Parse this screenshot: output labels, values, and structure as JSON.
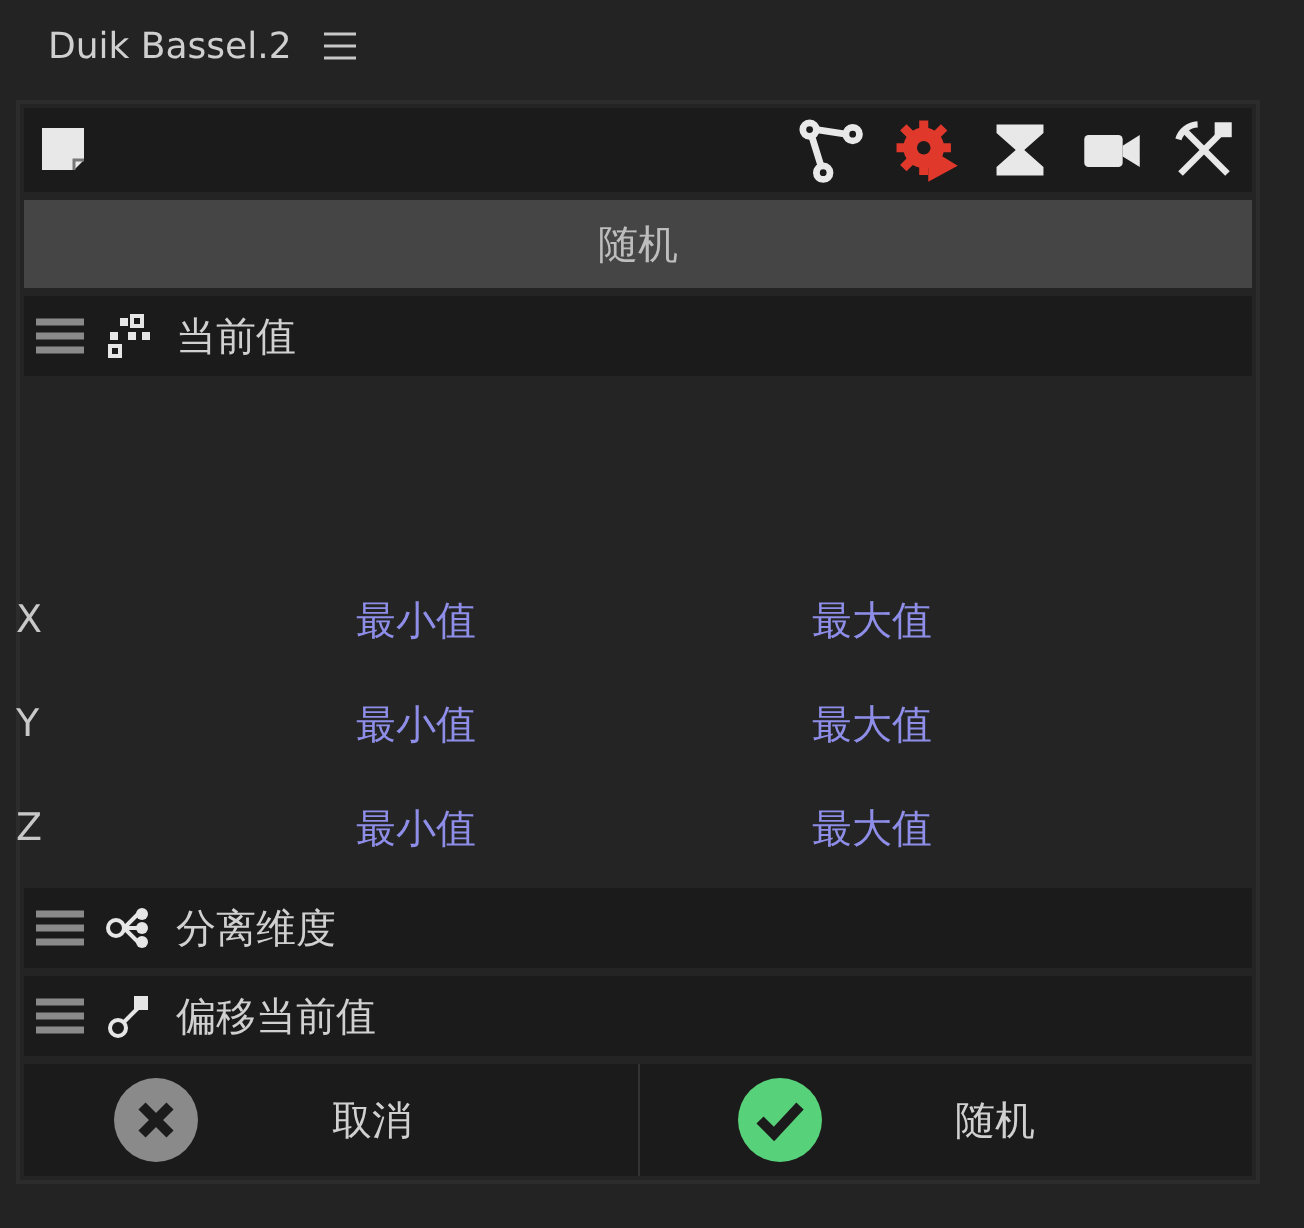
{
  "panel": {
    "title": "Duik Bassel.2"
  },
  "action_button": {
    "label": "随机"
  },
  "sections": [
    {
      "title": "当前值"
    },
    {
      "title": "分离维度"
    },
    {
      "title": "偏移当前值"
    }
  ],
  "axes": [
    {
      "axis": "X",
      "min": "最小值",
      "max": "最大值"
    },
    {
      "axis": "Y",
      "min": "最小值",
      "max": "最大值"
    },
    {
      "axis": "Z",
      "min": "最小值",
      "max": "最大值"
    }
  ],
  "footer": {
    "cancel": "取消",
    "confirm": "随机"
  }
}
